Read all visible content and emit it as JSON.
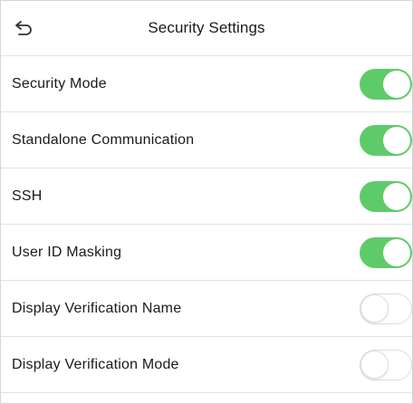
{
  "header": {
    "title": "Security Settings",
    "back_icon": "back-arrow-icon"
  },
  "colors": {
    "toggle_on": "#5ecb6b",
    "toggle_off_border": "#dcdcdc",
    "divider": "#e2e2e2"
  },
  "settings": [
    {
      "label": "Security Mode",
      "enabled": true
    },
    {
      "label": "Standalone Communication",
      "enabled": true
    },
    {
      "label": "SSH",
      "enabled": true
    },
    {
      "label": "User ID Masking",
      "enabled": true
    },
    {
      "label": "Display Verification Name",
      "enabled": false
    },
    {
      "label": "Display Verification Mode",
      "enabled": false
    }
  ]
}
